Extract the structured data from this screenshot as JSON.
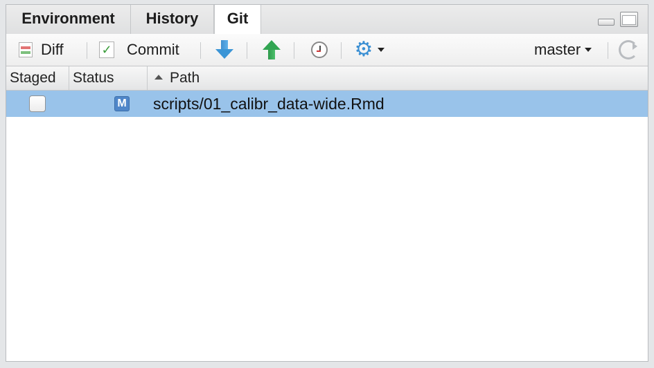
{
  "tabs": [
    {
      "label": "Environment"
    },
    {
      "label": "History"
    },
    {
      "label": "Git",
      "selected": true
    }
  ],
  "toolbar": {
    "diff_label": "Diff",
    "commit_label": "Commit",
    "branch": "master",
    "icons": [
      "diff-icon",
      "commit-icon",
      "pull-arrow-icon",
      "push-arrow-icon",
      "history-clock-icon",
      "gear-icon",
      "refresh-icon"
    ]
  },
  "table": {
    "columns": [
      "Staged",
      "Status",
      "Path"
    ],
    "sorted_column": "Path",
    "rows": [
      {
        "staged": false,
        "status": "M",
        "path": "scripts/01_calibr_data-wide.Rmd",
        "selected": true
      }
    ]
  },
  "colors": {
    "selected_row": "#99c3ea",
    "modified_badge": "#4f86c9",
    "pull_arrow": "#3b95d6",
    "push_arrow": "#32a552"
  }
}
